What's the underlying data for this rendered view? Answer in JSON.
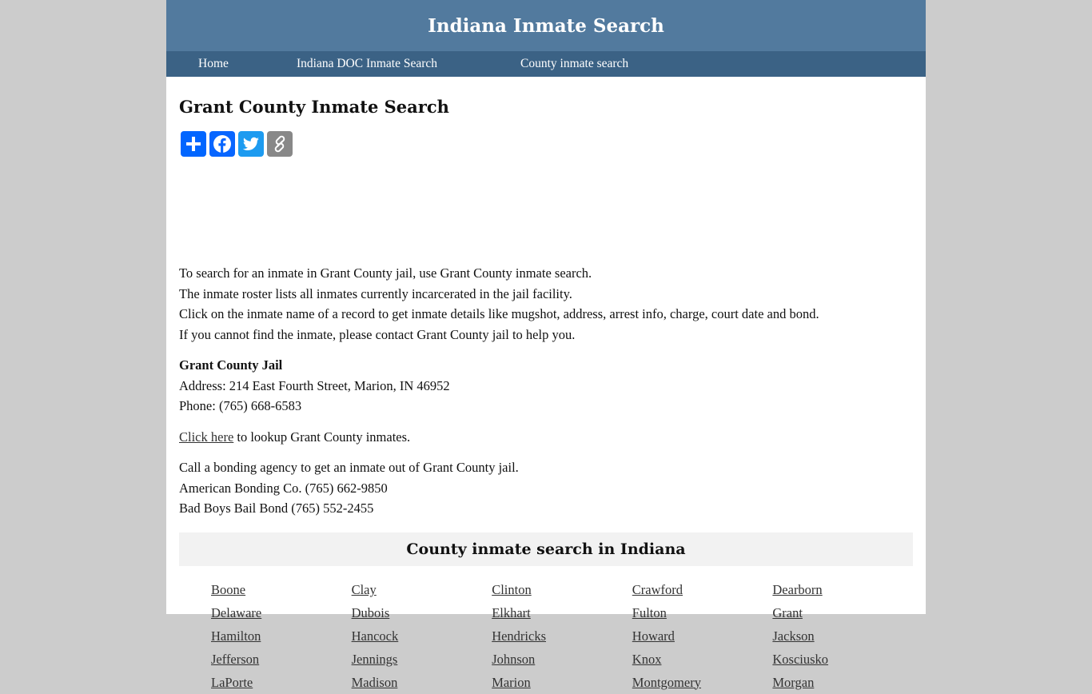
{
  "header": {
    "title": "Indiana Inmate Search"
  },
  "nav": {
    "items": [
      {
        "label": "Home"
      },
      {
        "label": "Indiana DOC Inmate Search"
      },
      {
        "label": "County inmate search"
      }
    ]
  },
  "main": {
    "title": "Grant County Inmate Search",
    "share": [
      {
        "icon": "share-plus-icon",
        "color": "#0166ff"
      },
      {
        "icon": "facebook-icon",
        "color": "#0866ff"
      },
      {
        "icon": "twitter-icon",
        "color": "#1d9bf0"
      },
      {
        "icon": "copy-link-icon",
        "color": "#888888"
      }
    ],
    "intro": [
      "To search for an inmate in Grant County jail, use Grant County inmate search.",
      "The inmate roster lists all inmates currently incarcerated in the jail facility.",
      "Click on the inmate name of a record to get inmate details like mugshot, address, arrest info, charge, court date and bond.",
      "If you cannot find the inmate, please contact Grant County jail to help you."
    ],
    "jail": {
      "name": "Grant County Jail",
      "address": "Address: 214 East Fourth Street, Marion, IN 46952",
      "phone": "Phone: (765) 668-6583"
    },
    "lookup": {
      "link_text": "Click here",
      "rest": " to lookup Grant County inmates."
    },
    "bonding": [
      "Call a bonding agency to get an inmate out of Grant County jail.",
      "American Bonding Co. (765) 662-9850",
      "Bad Boys Bail Bond (765) 552-2455"
    ]
  },
  "counties": {
    "heading": "County inmate search in Indiana",
    "items": [
      "Boone",
      "Clay",
      "Clinton",
      "Crawford",
      "Dearborn",
      "Delaware",
      "Dubois",
      "Elkhart",
      "Fulton",
      "Grant",
      "Hamilton",
      "Hancock",
      "Hendricks",
      "Howard",
      "Jackson",
      "Jefferson",
      "Jennings",
      "Johnson",
      "Knox",
      "Kosciusko",
      "LaPorte",
      "Madison",
      "Marion",
      "Montgomery",
      "Morgan"
    ]
  }
}
